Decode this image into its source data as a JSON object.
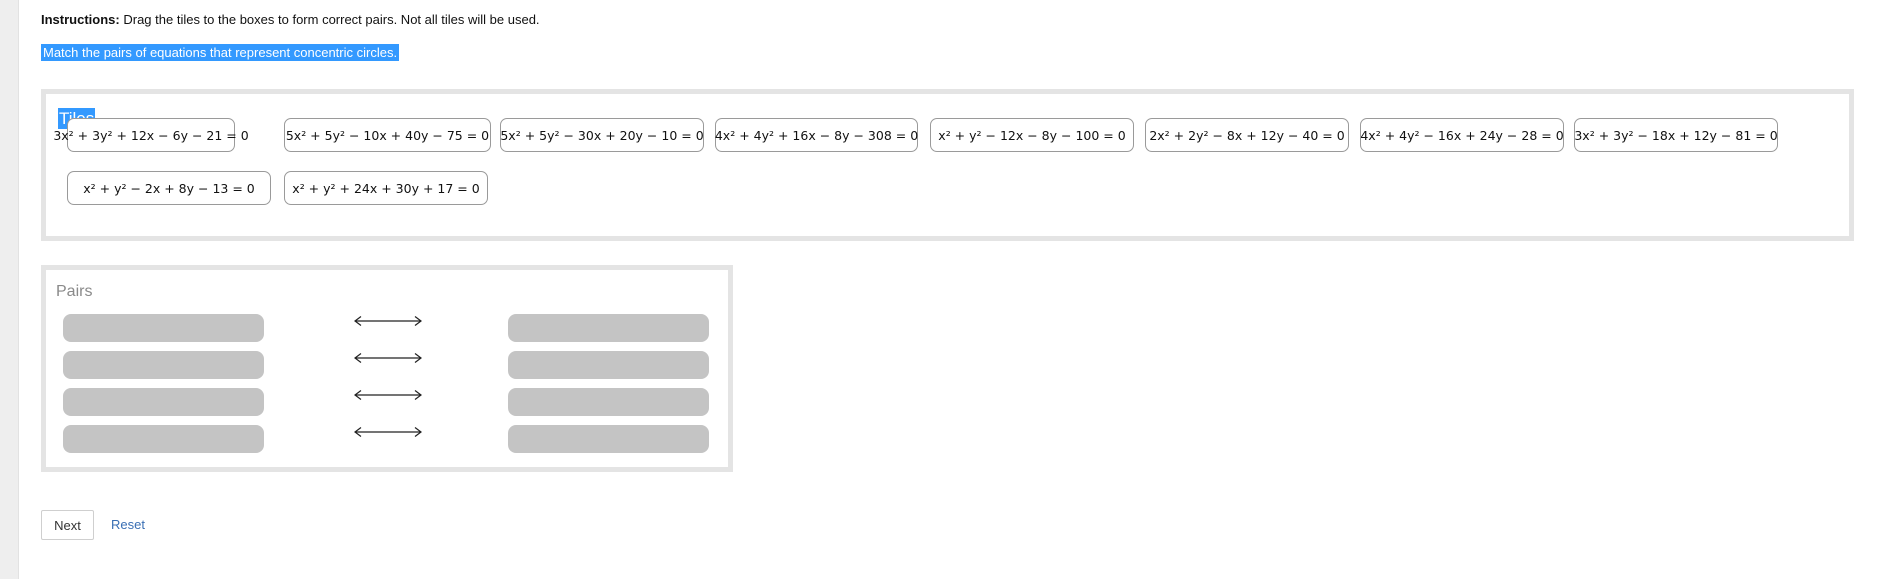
{
  "instructions": {
    "label": "Instructions:",
    "text": "Drag the tiles to the boxes to form correct pairs. Not all tiles will be used."
  },
  "prompt": "Match the pairs of equations that represent concentric circles.",
  "tiles_section": {
    "title": "Tiles",
    "tiles": [
      "3x² + 3y² + 12x − 6y − 21 = 0",
      "5x² + 5y² − 10x + 40y − 75 = 0",
      "5x² + 5y² − 30x + 20y − 10 = 0",
      "4x² + 4y² + 16x − 8y − 308 = 0",
      "x² + y² − 12x − 8y − 100 = 0",
      "2x² + 2y² − 8x + 12y − 40 = 0",
      "4x² + 4y² − 16x + 24y − 28 = 0",
      "3x² + 3y² − 18x + 12y − 81 = 0",
      "x² + y² − 2x + 8y − 13 = 0",
      "x² + y² + 24x + 30y + 17 = 0"
    ]
  },
  "pairs_section": {
    "title": "Pairs",
    "rows": 4
  },
  "buttons": {
    "next": "Next",
    "reset": "Reset"
  },
  "colors": {
    "selection": "#3399ff",
    "slot": "#c4c4c4",
    "box_border": "#e4e4e4",
    "link": "#3a6fb4"
  }
}
